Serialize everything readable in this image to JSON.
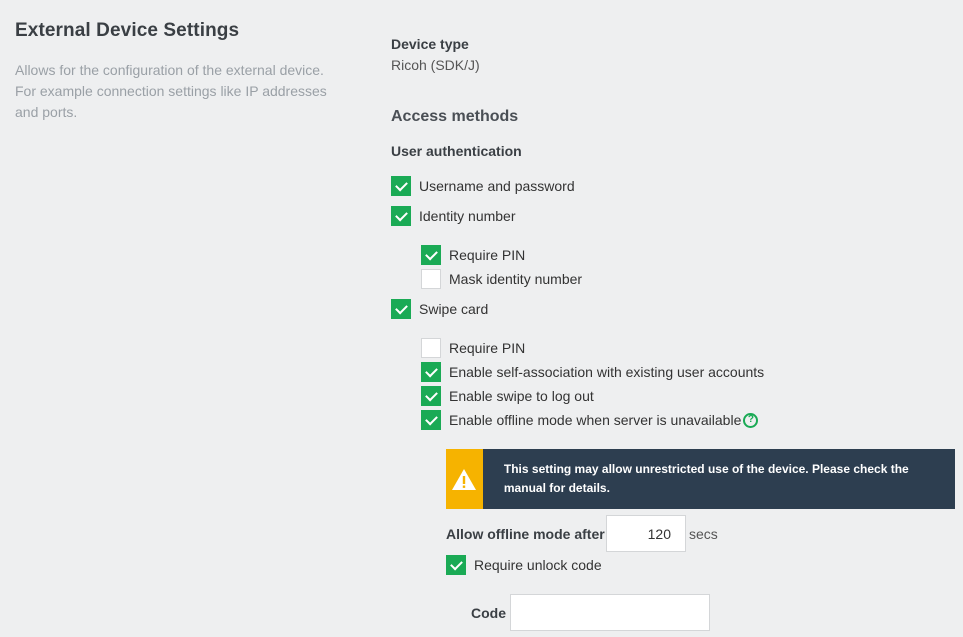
{
  "left": {
    "title": "External Device Settings",
    "description": "Allows for the configuration of the external device. For example connection settings like IP addresses and ports."
  },
  "device": {
    "type_label": "Device type",
    "type_value": "Ricoh (SDK/J)"
  },
  "access": {
    "title": "Access methods",
    "user_auth_label": "User authentication",
    "username_password": {
      "label": "Username and password",
      "checked": true
    },
    "identity_number": {
      "label": "Identity number",
      "checked": true
    },
    "identity_require_pin": {
      "label": "Require PIN",
      "checked": true
    },
    "mask_identity_number": {
      "label": "Mask identity number",
      "checked": false
    },
    "swipe_card": {
      "label": "Swipe card",
      "checked": true
    },
    "swipe_require_pin": {
      "label": "Require PIN",
      "checked": false
    },
    "self_association": {
      "label": "Enable self-association with existing user accounts",
      "checked": true
    },
    "swipe_logout": {
      "label": "Enable swipe to log out",
      "checked": true
    },
    "offline_mode": {
      "label": "Enable offline mode when server is unavailable",
      "checked": true,
      "help_icon": "question-circle-icon"
    }
  },
  "warning": {
    "icon": "warning-triangle-icon",
    "text": "This setting may allow unrestricted use of the device. Please check the manual for details.",
    "colors": {
      "icon_bg": "#f6b300",
      "bg": "#2d3e50"
    }
  },
  "offline": {
    "after_label": "Allow offline mode after",
    "after_value": "120",
    "unit": "secs",
    "require_unlock": {
      "label": "Require unlock code",
      "checked": true
    },
    "code_label": "Code",
    "code_value": ""
  },
  "colors": {
    "accent": "#1aaa55",
    "background": "#eeeff0"
  }
}
